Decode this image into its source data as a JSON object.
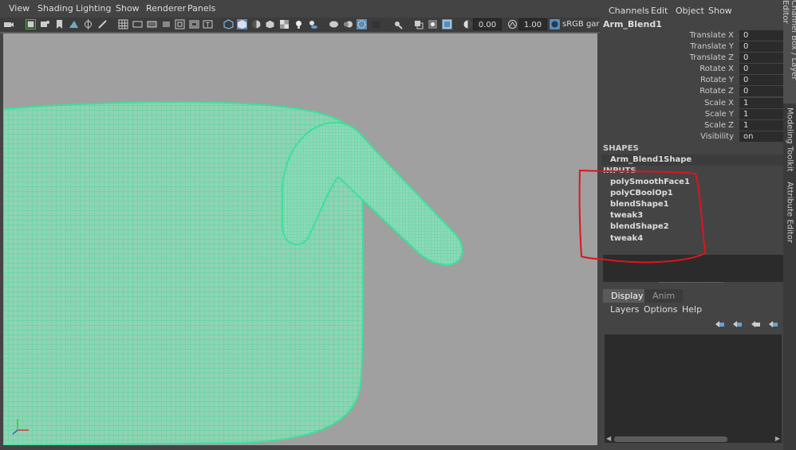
{
  "viewport": {
    "menu": [
      "View",
      "Shading",
      "Lighting",
      "Show",
      "Renderer",
      "Panels"
    ],
    "toolbar": {
      "value1": "0.00",
      "value2": "1.00",
      "colorspace": "sRGB gar"
    },
    "colors": {
      "canvas": "#a0a0a0",
      "wireframe": "#3ee09a"
    }
  },
  "channel_box": {
    "menu": [
      "Channels",
      "Edit",
      "Object",
      "Show"
    ],
    "object_name": "Arm_Blend1",
    "attributes": [
      {
        "label": "Translate X",
        "value": "0"
      },
      {
        "label": "Translate Y",
        "value": "0"
      },
      {
        "label": "Translate Z",
        "value": "0"
      },
      {
        "label": "Rotate X",
        "value": "0"
      },
      {
        "label": "Rotate Y",
        "value": "0"
      },
      {
        "label": "Rotate Z",
        "value": "0"
      },
      {
        "label": "Scale X",
        "value": "1"
      },
      {
        "label": "Scale Y",
        "value": "1"
      },
      {
        "label": "Scale Z",
        "value": "1"
      },
      {
        "label": "Visibility",
        "value": "on"
      }
    ],
    "shapes_header": "SHAPES",
    "shape_name": "Arm_Blend1Shape",
    "inputs_header": "INPUTS",
    "inputs": [
      "polySmoothFace1",
      "polyCBoolOp1",
      "blendShape1",
      "tweak3",
      "blendShape2",
      "tweak4"
    ]
  },
  "layer_editor": {
    "tabs": [
      "Display",
      "Anim"
    ],
    "menu": [
      "Layers",
      "Options",
      "Help"
    ]
  },
  "side_tabs": [
    "Channel Box / Layer Editor",
    "Modeling Toolkit",
    "Attribute Editor"
  ],
  "annotation_color": "#e0141e"
}
